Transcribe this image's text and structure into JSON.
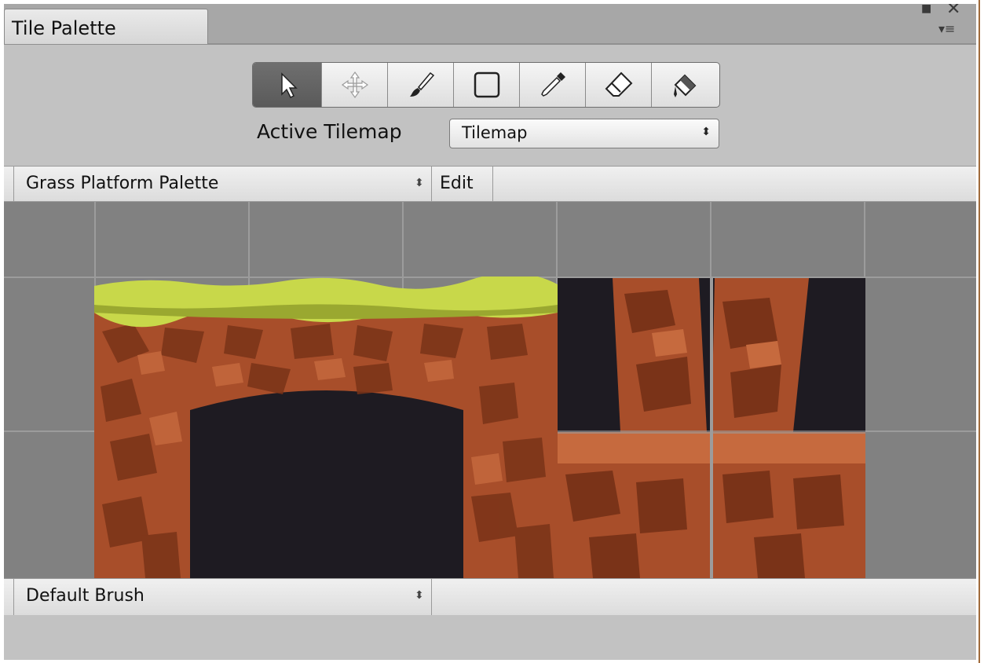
{
  "window": {
    "tab_title": "Tile Palette"
  },
  "window_controls": {
    "maximize_glyph": "■",
    "close_glyph": "✕",
    "menu_glyph": "▾≡"
  },
  "toolbar": {
    "tools": [
      {
        "name": "select",
        "icon": "select-arrow-icon",
        "active": true
      },
      {
        "name": "move",
        "icon": "move-arrows-icon",
        "active": false
      },
      {
        "name": "paint",
        "icon": "paintbrush-icon",
        "active": false
      },
      {
        "name": "box-fill",
        "icon": "rectangle-icon",
        "active": false
      },
      {
        "name": "pick",
        "icon": "eyedropper-icon",
        "active": false
      },
      {
        "name": "erase",
        "icon": "eraser-icon",
        "active": false
      },
      {
        "name": "fill",
        "icon": "paint-bucket-icon",
        "active": false
      }
    ]
  },
  "active_tilemap": {
    "label": "Active Tilemap",
    "value": "Tilemap",
    "arrow": "⬍"
  },
  "palette_bar": {
    "palette_name": "Grass Platform Palette",
    "arrow": "⬍",
    "edit_label": "Edit"
  },
  "brush_bar": {
    "brush_name": "Default Brush",
    "arrow": "⬍"
  },
  "colors": {
    "grass": "#c8d84a",
    "dirt": "#a84e2a",
    "dirt_dark": "#7a3318",
    "dirt_light": "#c66a3e",
    "cave": "#1e1b22",
    "grid_bg": "#818181",
    "grid_line": "#9c9c9c"
  }
}
